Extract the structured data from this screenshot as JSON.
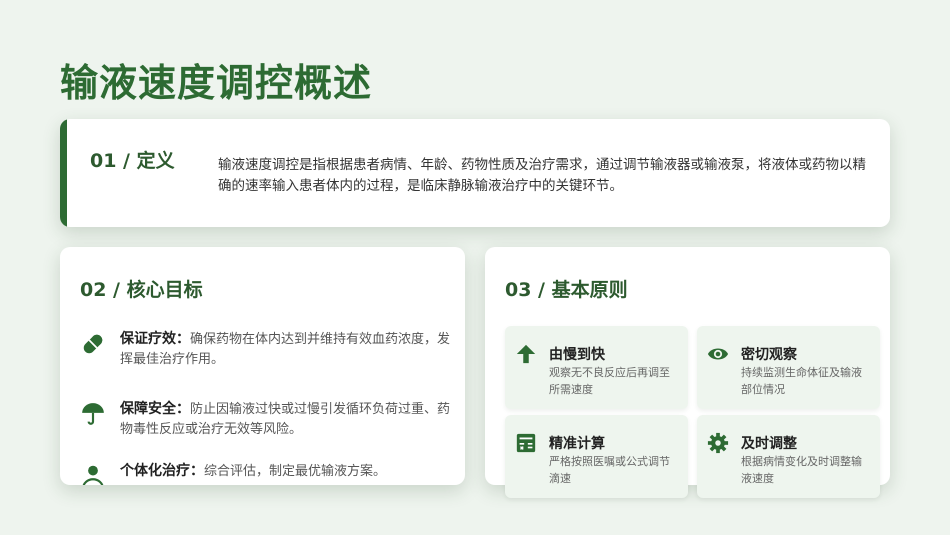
{
  "page": {
    "title": "输液速度调控概述"
  },
  "definition": {
    "number": "01 /",
    "heading": "定义",
    "text": "输液速度调控是指根据患者病情、年龄、药物性质及治疗需求，通过调节输液器或输液泵，将液体或药物以精确的速率输入患者体内的过程，是临床静脉输液治疗中的关键环节。"
  },
  "goals": {
    "number": "02 /",
    "heading": "核心目标",
    "items": [
      {
        "icon": "pill-icon",
        "title": "保证疗效：",
        "text": "确保药物在体内达到并维持有效血药浓度，发挥最佳治疗作用。"
      },
      {
        "icon": "umbrella-icon",
        "title": "保障安全：",
        "text": "防止因输液过快或过慢引发循环负荷过重、药物毒性反应或治疗无效等风险。"
      },
      {
        "icon": "user-icon",
        "title": "个体化治疗：",
        "text": "综合评估，制定最优输液方案。"
      }
    ]
  },
  "principles": {
    "number": "03 /",
    "heading": "基本原则",
    "items": [
      {
        "icon": "arrow-up-icon",
        "title": "由慢到快",
        "text": "观察无不良反应后再调至所需速度"
      },
      {
        "icon": "eye-icon",
        "title": "密切观察",
        "text": "持续监测生命体征及输液部位情况"
      },
      {
        "icon": "calculator-icon",
        "title": "精准计算",
        "text": "严格按照医嘱或公式调节滴速"
      },
      {
        "icon": "gear-icon",
        "title": "及时调整",
        "text": "根据病情变化及时调整输液速度"
      }
    ]
  },
  "colors": {
    "accent": "#2d6b33",
    "background": "#eef4ee",
    "tile": "#eef5ee"
  }
}
